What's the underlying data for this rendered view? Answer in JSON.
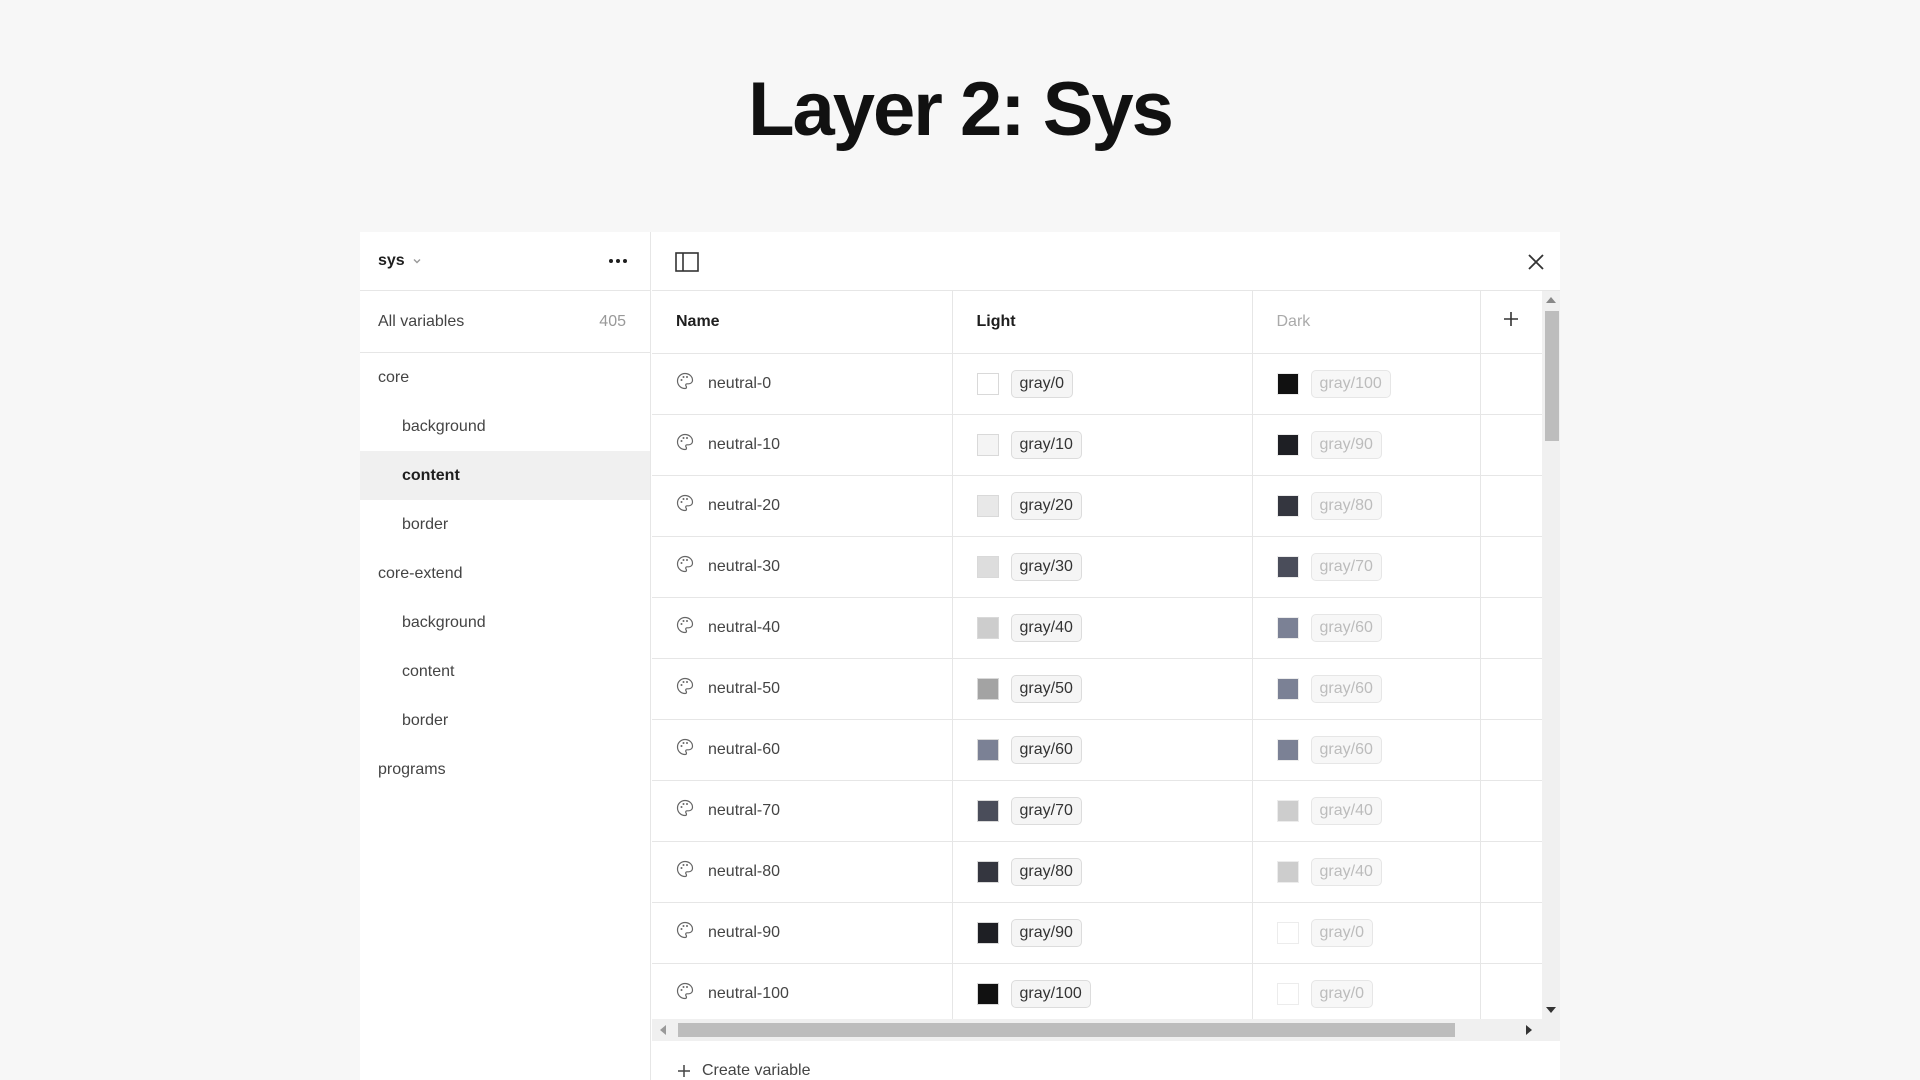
{
  "page": {
    "title": "Layer 2: Sys"
  },
  "sidebar": {
    "collection": "sys",
    "all_variables_label": "All variables",
    "all_variables_count": "405",
    "groups": [
      {
        "label": "core",
        "items": [
          {
            "label": "background",
            "active": false
          },
          {
            "label": "content",
            "active": true
          },
          {
            "label": "border",
            "active": false
          }
        ]
      },
      {
        "label": "core-extend",
        "items": [
          {
            "label": "background",
            "active": false
          },
          {
            "label": "content",
            "active": false
          },
          {
            "label": "border",
            "active": false
          }
        ]
      },
      {
        "label": "programs",
        "items": []
      }
    ]
  },
  "table": {
    "columns": {
      "name": "Name",
      "light": "Light",
      "dark": "Dark"
    },
    "rows": [
      {
        "name": "neutral-0",
        "light": {
          "alias": "gray/0",
          "color": "#ffffff"
        },
        "dark": {
          "alias": "gray/100",
          "color": "#111111"
        }
      },
      {
        "name": "neutral-10",
        "light": {
          "alias": "gray/10",
          "color": "#f4f4f4"
        },
        "dark": {
          "alias": "gray/90",
          "color": "#1e1f24"
        }
      },
      {
        "name": "neutral-20",
        "light": {
          "alias": "gray/20",
          "color": "#e8e8e8"
        },
        "dark": {
          "alias": "gray/80",
          "color": "#34363f"
        }
      },
      {
        "name": "neutral-30",
        "light": {
          "alias": "gray/30",
          "color": "#dddddd"
        },
        "dark": {
          "alias": "gray/70",
          "color": "#4a4d5a"
        }
      },
      {
        "name": "neutral-40",
        "light": {
          "alias": "gray/40",
          "color": "#cdcdcd"
        },
        "dark": {
          "alias": "gray/60",
          "color": "#7b8195"
        }
      },
      {
        "name": "neutral-50",
        "light": {
          "alias": "gray/50",
          "color": "#a3a3a3"
        },
        "dark": {
          "alias": "gray/60",
          "color": "#7b8195"
        }
      },
      {
        "name": "neutral-60",
        "light": {
          "alias": "gray/60",
          "color": "#7b8195"
        },
        "dark": {
          "alias": "gray/60",
          "color": "#7b8195"
        }
      },
      {
        "name": "neutral-70",
        "light": {
          "alias": "gray/70",
          "color": "#4a4d5a"
        },
        "dark": {
          "alias": "gray/40",
          "color": "#cdcdcd"
        }
      },
      {
        "name": "neutral-80",
        "light": {
          "alias": "gray/80",
          "color": "#34363f"
        },
        "dark": {
          "alias": "gray/40",
          "color": "#cdcdcd"
        }
      },
      {
        "name": "neutral-90",
        "light": {
          "alias": "gray/90",
          "color": "#1e1f24"
        },
        "dark": {
          "alias": "gray/0",
          "color": "#ffffff"
        }
      },
      {
        "name": "neutral-100",
        "light": {
          "alias": "gray/100",
          "color": "#111111"
        },
        "dark": {
          "alias": "gray/0",
          "color": "#ffffff"
        }
      }
    ]
  },
  "footer": {
    "create_label": "Create variable"
  },
  "icons": {
    "variable": "palette-icon",
    "add_mode": "plus-icon",
    "toggle_sidebar": "sidebar-panel-icon",
    "close": "close-icon"
  }
}
